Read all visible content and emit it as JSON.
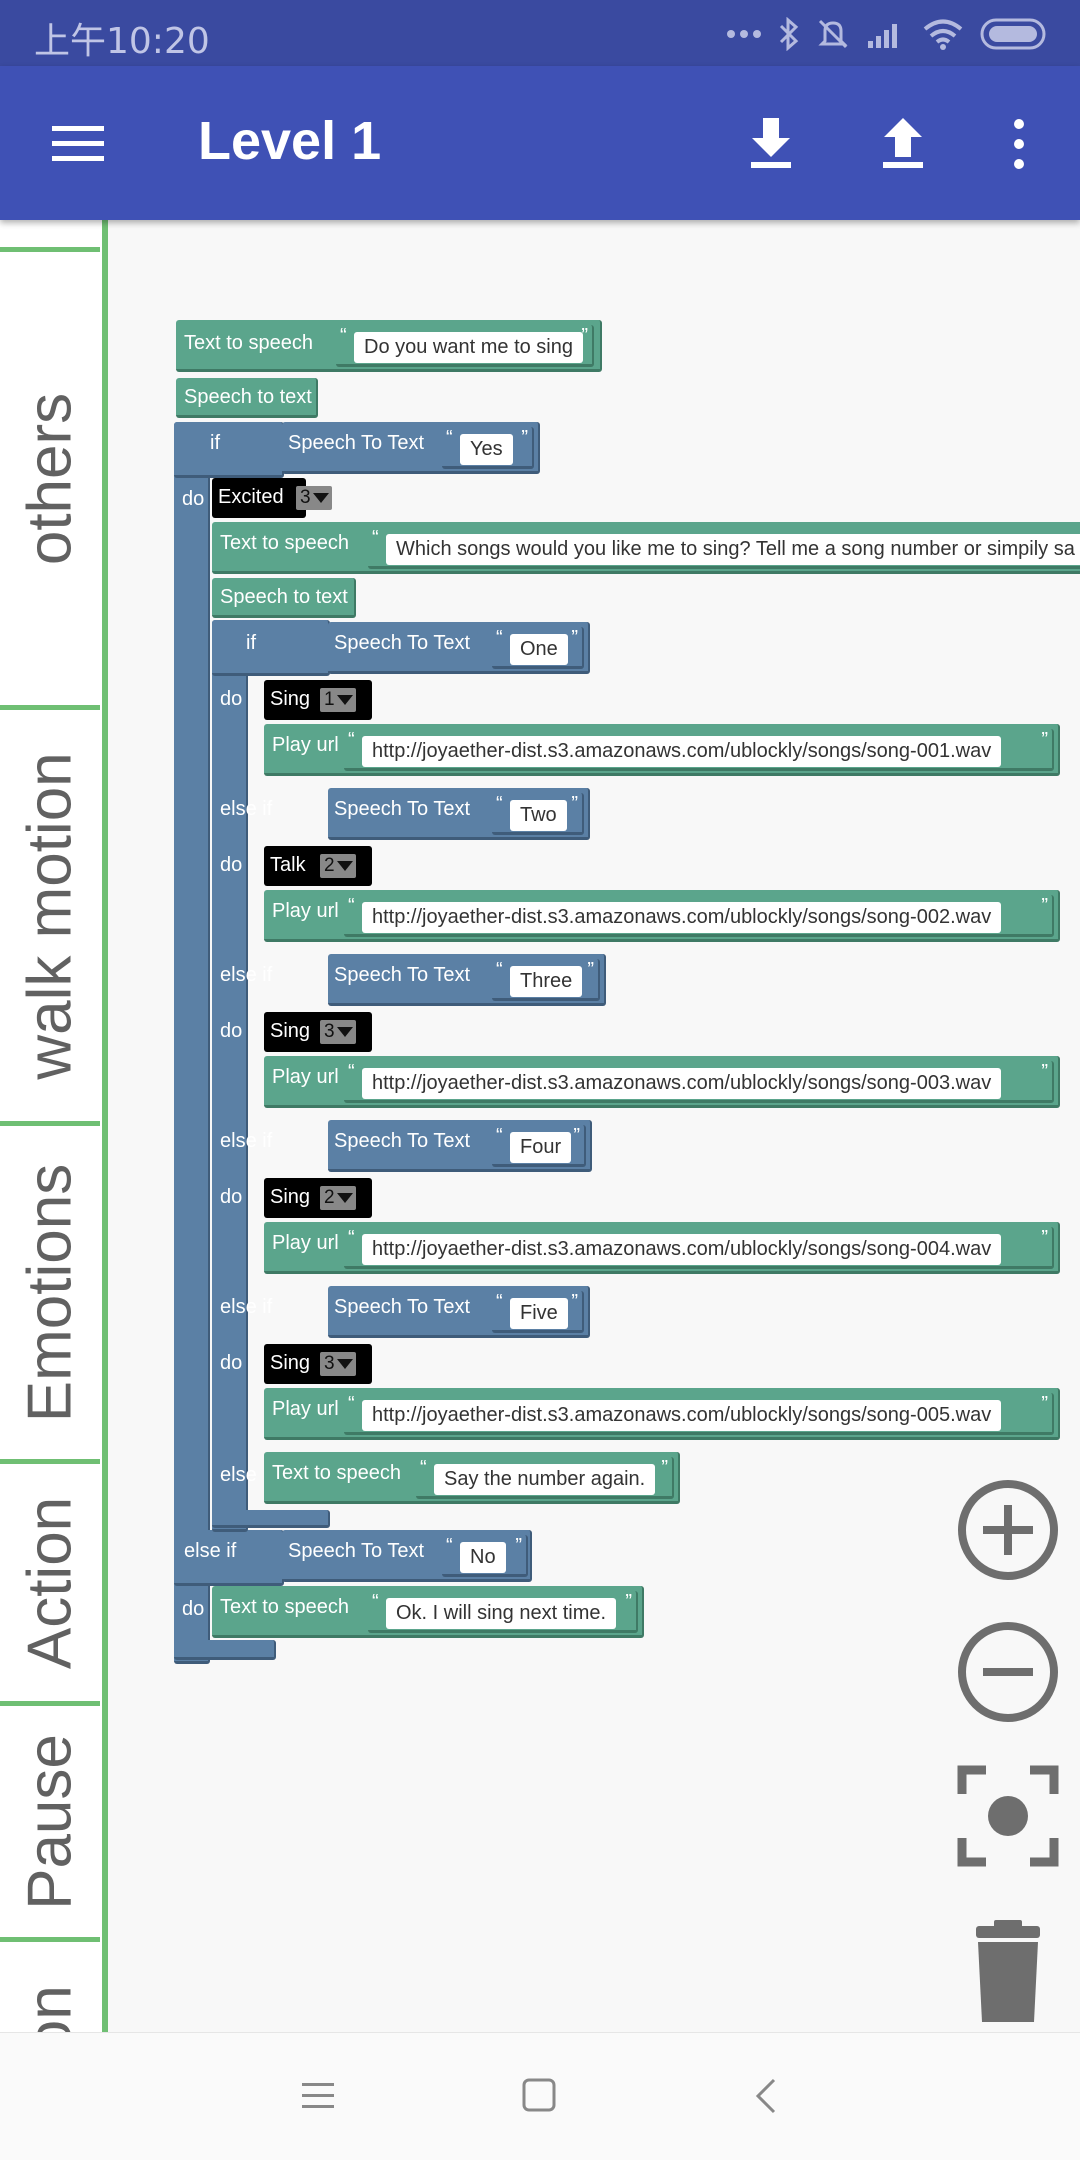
{
  "status_bar": {
    "time": "上午10:20",
    "icons": [
      "more-dots-icon",
      "bluetooth-icon",
      "silent-icon",
      "signal-icon",
      "wifi-icon",
      "battery-icon"
    ]
  },
  "app_bar": {
    "title": "Level 1",
    "icons": [
      "menu-icon",
      "download-icon",
      "upload-icon",
      "more-vert-icon"
    ]
  },
  "sidebar": {
    "categories": [
      {
        "label": "others"
      },
      {
        "label": "walk motion"
      },
      {
        "label": "Emotions"
      },
      {
        "label": "Action"
      },
      {
        "label": "Pause"
      },
      {
        "label": "Emotion"
      }
    ]
  },
  "program": {
    "tts1": {
      "label": "Text to speech",
      "text": "Do you want me to sing"
    },
    "stt1": "Speech to text",
    "if_label": "if",
    "do_label": "do",
    "elseif_label": "else if",
    "else_label": "else",
    "cond_label": "Speech To Text",
    "cond1_value": "Yes",
    "excited": {
      "label": "Excited",
      "value": "3"
    },
    "tts2": {
      "label": "Text to speech",
      "text": "Which songs would you like me to sing? Tell me a song number or simpily sa"
    },
    "stt2": "Speech to text",
    "branches": [
      {
        "kw": "if",
        "value": "One",
        "action": "Sing",
        "action_value": "1",
        "play_label": "Play url",
        "url": "http://joyaether-dist.s3.amazonaws.com/ublockly/songs/song-001.wav"
      },
      {
        "kw": "else if",
        "value": "Two",
        "action": "Talk",
        "action_value": "2",
        "play_label": "Play url",
        "url": "http://joyaether-dist.s3.amazonaws.com/ublockly/songs/song-002.wav"
      },
      {
        "kw": "else if",
        "value": "Three",
        "action": "Sing",
        "action_value": "3",
        "play_label": "Play url",
        "url": "http://joyaether-dist.s3.amazonaws.com/ublockly/songs/song-003.wav"
      },
      {
        "kw": "else if",
        "value": "Four",
        "action": "Sing",
        "action_value": "2",
        "play_label": "Play url",
        "url": "http://joyaether-dist.s3.amazonaws.com/ublockly/songs/song-004.wav"
      },
      {
        "kw": "else if",
        "value": "Five",
        "action": "Sing",
        "action_value": "3",
        "play_label": "Play url",
        "url": "http://joyaether-dist.s3.amazonaws.com/ublockly/songs/song-005.wav"
      }
    ],
    "inner_else_tts": {
      "label": "Text to speech",
      "text": "Say the number again."
    },
    "outer_elseif_value": "No",
    "outer_do_tts": {
      "label": "Text to speech",
      "text": "Ok. I will sing next time."
    }
  },
  "workspace_controls": [
    "zoom-in-icon",
    "zoom-out-icon",
    "recenter-icon",
    "trash-icon"
  ],
  "nav_bar": [
    "menu-nav-icon",
    "home-nav-icon",
    "back-nav-icon"
  ]
}
